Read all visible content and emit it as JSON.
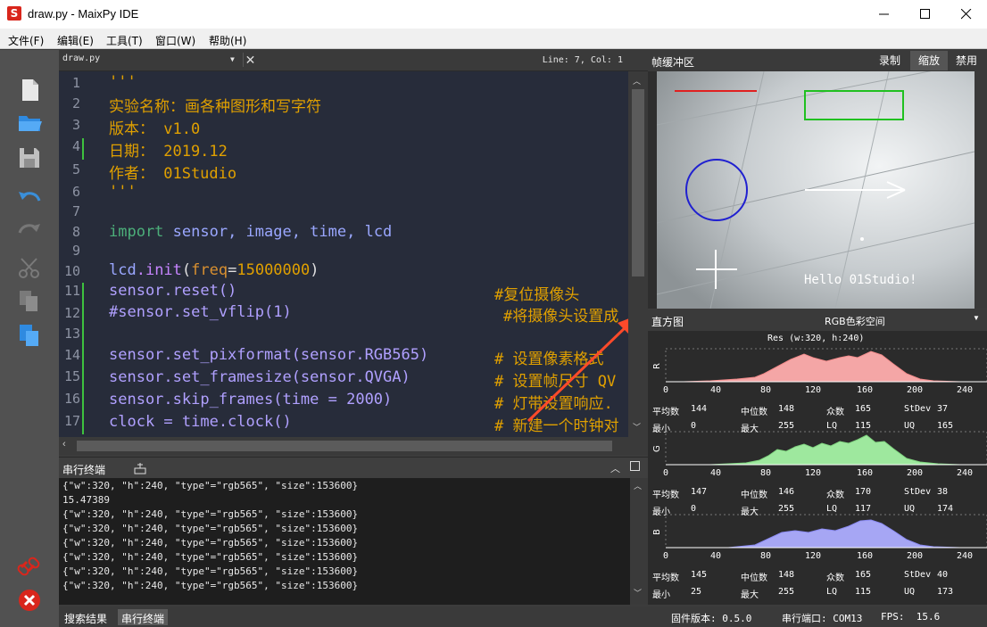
{
  "window": {
    "title": "draw.py - MaixPy IDE",
    "app_icon_letter": "S"
  },
  "menu": [
    "文件(F)",
    "编辑(E)",
    "工具(T)",
    "窗口(W)",
    "帮助(H)"
  ],
  "editor": {
    "filename": "draw.py",
    "cursor": "Line: 7, Col: 1",
    "line_numbers": [
      "1",
      "2",
      "3",
      "4",
      "5",
      "6",
      "7",
      "8",
      "9",
      "10",
      "11",
      "12",
      "13",
      "14",
      "15",
      "16",
      "17"
    ],
    "code": {
      "l1": "'''",
      "l2": "实验名称：画各种图形和写字符",
      "l3": "版本： v1.0",
      "l4": "日期： 2019.12",
      "l5": "作者： 01Studio",
      "l6": "'''",
      "l8_kw": "import",
      "l8_rest": " sensor, image, time, lcd",
      "l10_mod": "lcd",
      "l10_fn": ".init",
      "l10_p1": "(",
      "l10_arg": "freq",
      "l10_eq": "=",
      "l10_num": "15000000",
      "l10_p2": ")",
      "l11_code": "sensor.reset()",
      "l11_com": "#复位摄像头",
      "l12_code": "#sensor.set_vflip(1)",
      "l12_com": "#将摄像头设置成",
      "l14_code": "sensor.set_pixformat(sensor.RGB565)",
      "l14_com": "# 设置像素格式",
      "l15_code": "sensor.set_framesize(sensor.QVGA)",
      "l15_com": "# 设置帧尺寸 QV",
      "l16_code": "sensor.skip_frames(time = 2000)",
      "l16_com": "# 灯带设置响应.",
      "l17_code": "clock = time.clock()",
      "l17_com": "# 新建一个时钟对"
    }
  },
  "terminal": {
    "title": "串行终端",
    "lines": [
      "{\"w\":320, \"h\":240, \"type\"=\"rgb565\", \"size\":153600}",
      "15.47389",
      "{\"w\":320, \"h\":240, \"type\"=\"rgb565\", \"size\":153600}",
      "{\"w\":320, \"h\":240, \"type\"=\"rgb565\", \"size\":153600}",
      "{\"w\":320, \"h\":240, \"type\"=\"rgb565\", \"size\":153600}",
      "{\"w\":320, \"h\":240, \"type\"=\"rgb565\", \"size\":153600}",
      "{\"w\":320, \"h\":240, \"type\"=\"rgb565\", \"size\":153600}",
      "{\"w\":320, \"h\":240, \"type\"=\"rgb565\", \"size\":153600}"
    ]
  },
  "bottom_tabs": {
    "search": "搜索结果",
    "serial": "串行终端"
  },
  "framebuffer": {
    "title": "帧缓冲区",
    "buttons": {
      "record": "录制",
      "zoom": "缩放",
      "disable": "禁用"
    },
    "overlay_text": "Hello 01Studio!"
  },
  "histogram": {
    "title": "直方图",
    "colorspace": "RGB色彩空间",
    "res": "Res (w:320, h:240)",
    "ticks": [
      "0",
      "40",
      "80",
      "120",
      "160",
      "200",
      "240"
    ],
    "channels": [
      {
        "label": "R",
        "color": "#f4a6a6",
        "stats": {
          "mean": "144",
          "median": "148",
          "mode": "165",
          "stdev": "37",
          "min": "0",
          "max": "255",
          "lq": "115",
          "uq": "165"
        }
      },
      {
        "label": "G",
        "color": "#9ee89e",
        "stats": {
          "mean": "147",
          "median": "146",
          "mode": "170",
          "stdev": "38",
          "min": "0",
          "max": "255",
          "lq": "117",
          "uq": "174"
        }
      },
      {
        "label": "B",
        "color": "#a6a6f4",
        "stats": {
          "mean": "145",
          "median": "148",
          "mode": "165",
          "stdev": "40",
          "min": "25",
          "max": "255",
          "lq": "115",
          "uq": "173"
        }
      }
    ],
    "stat_labels": {
      "mean": "平均数",
      "median": "中位数",
      "mode": "众数",
      "stdev": "StDev",
      "min": "最小",
      "max": "最大",
      "lq": "LQ",
      "uq": "UQ"
    }
  },
  "status": {
    "firmware": "固件版本: 0.5.0",
    "serial_port": "串行端口: COM13",
    "fps": "FPS:  15.6"
  },
  "colors": {
    "accent": "#3a8fd9",
    "toolbar": "#515151",
    "editor_bg": "#272c3a"
  }
}
